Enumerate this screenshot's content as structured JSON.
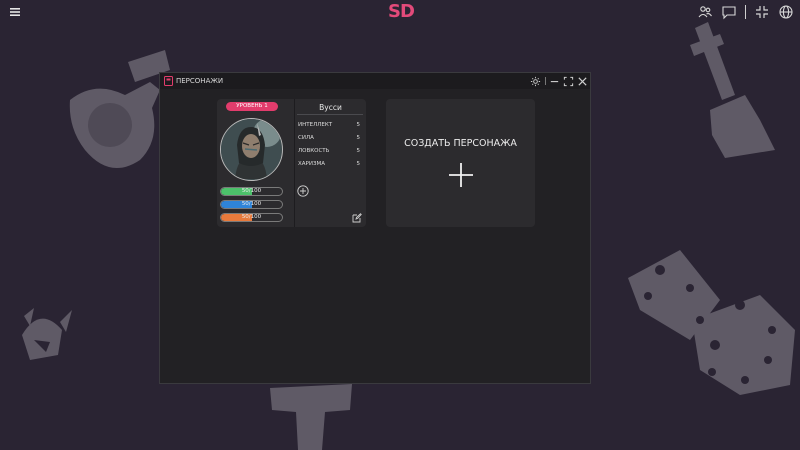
{
  "topbar": {
    "logo": "SD",
    "icons": [
      "menu-icon",
      "users-icon",
      "chat-icon",
      "collapse-icon",
      "globe-icon"
    ]
  },
  "window": {
    "title": "ПЕРСОНАЖИ",
    "controls": [
      "gear-icon",
      "minimize-icon",
      "maximize-icon",
      "close-icon"
    ]
  },
  "character": {
    "level": "УРОВЕНЬ 1",
    "name": "Вусси",
    "stats": [
      {
        "label": "ИНТЕЛЛЕКТ",
        "value": "5"
      },
      {
        "label": "СИЛА",
        "value": "5"
      },
      {
        "label": "ЛОВКОСТЬ",
        "value": "5"
      },
      {
        "label": "ХАРИЗМА",
        "value": "5"
      }
    ],
    "bars": [
      {
        "text": "50/100",
        "value": 50,
        "max": 100,
        "color": "#4cc16a"
      },
      {
        "text": "50/100",
        "value": 50,
        "max": 100,
        "color": "#2f84d8"
      },
      {
        "text": "50/100",
        "value": 50,
        "max": 100,
        "color": "#e87a3c"
      }
    ]
  },
  "create_card": {
    "label": "СОЗДАТЬ ПЕРСОНАЖА"
  },
  "colors": {
    "background": "#2a2433",
    "accent": "#e23c6c",
    "window_bg": "#222124",
    "card_bg": "#2c2b2e",
    "decor": "#5f5a66"
  }
}
